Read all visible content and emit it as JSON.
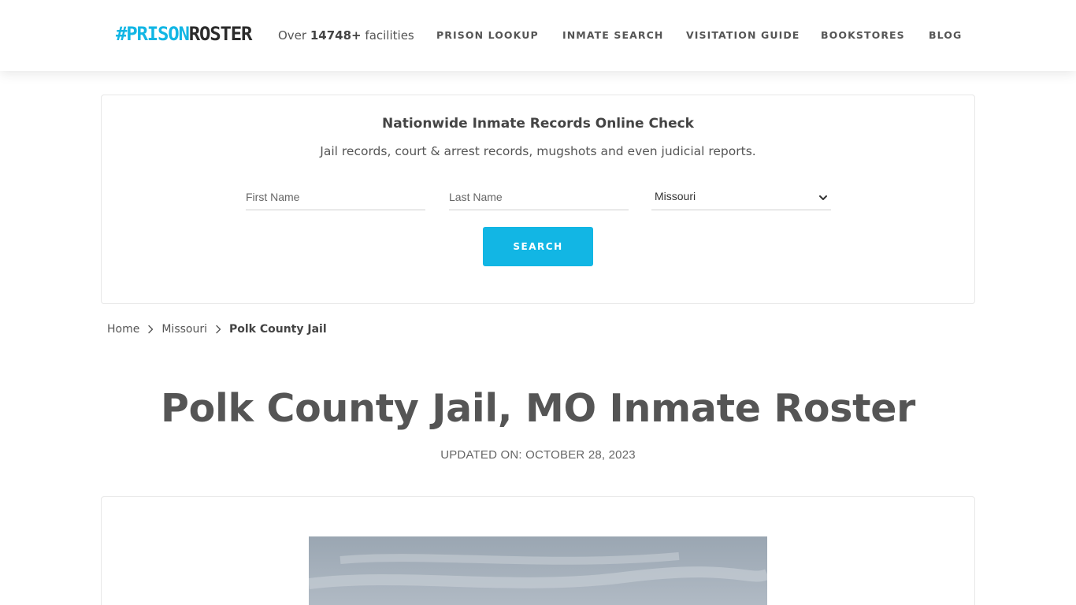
{
  "header": {
    "logo": {
      "hash": "#",
      "prison": "PRISON",
      "roster": "ROSTER"
    },
    "facility_count": {
      "prefix": "Over",
      "count": "14748+",
      "suffix": "facilities"
    },
    "nav": [
      {
        "label": "PRISON LOOKUP"
      },
      {
        "label": "INMATE SEARCH"
      },
      {
        "label": "VISITATION GUIDE"
      },
      {
        "label": "BOOKSTORES"
      },
      {
        "label": "BLOG"
      }
    ]
  },
  "search": {
    "title": "Nationwide Inmate Records Online Check",
    "subtitle": "Jail records, court & arrest records, mugshots and even judicial reports.",
    "first_name_placeholder": "First Name",
    "last_name_placeholder": "Last Name",
    "state_value": "Missouri",
    "button_label": "SEARCH"
  },
  "breadcrumb": {
    "home": "Home",
    "state": "Missouri",
    "current": "Polk County Jail"
  },
  "page": {
    "title": "Polk County Jail, MO Inmate Roster",
    "updated": "UPDATED ON: OCTOBER 28, 2023"
  },
  "colors": {
    "accent": "#12b6e4",
    "text": "#555555",
    "logo_dark": "#2b2b2b"
  },
  "icons": {
    "breadcrumb_separator": "chevron-right-icon",
    "select_arrow": "chevron-down-icon"
  }
}
